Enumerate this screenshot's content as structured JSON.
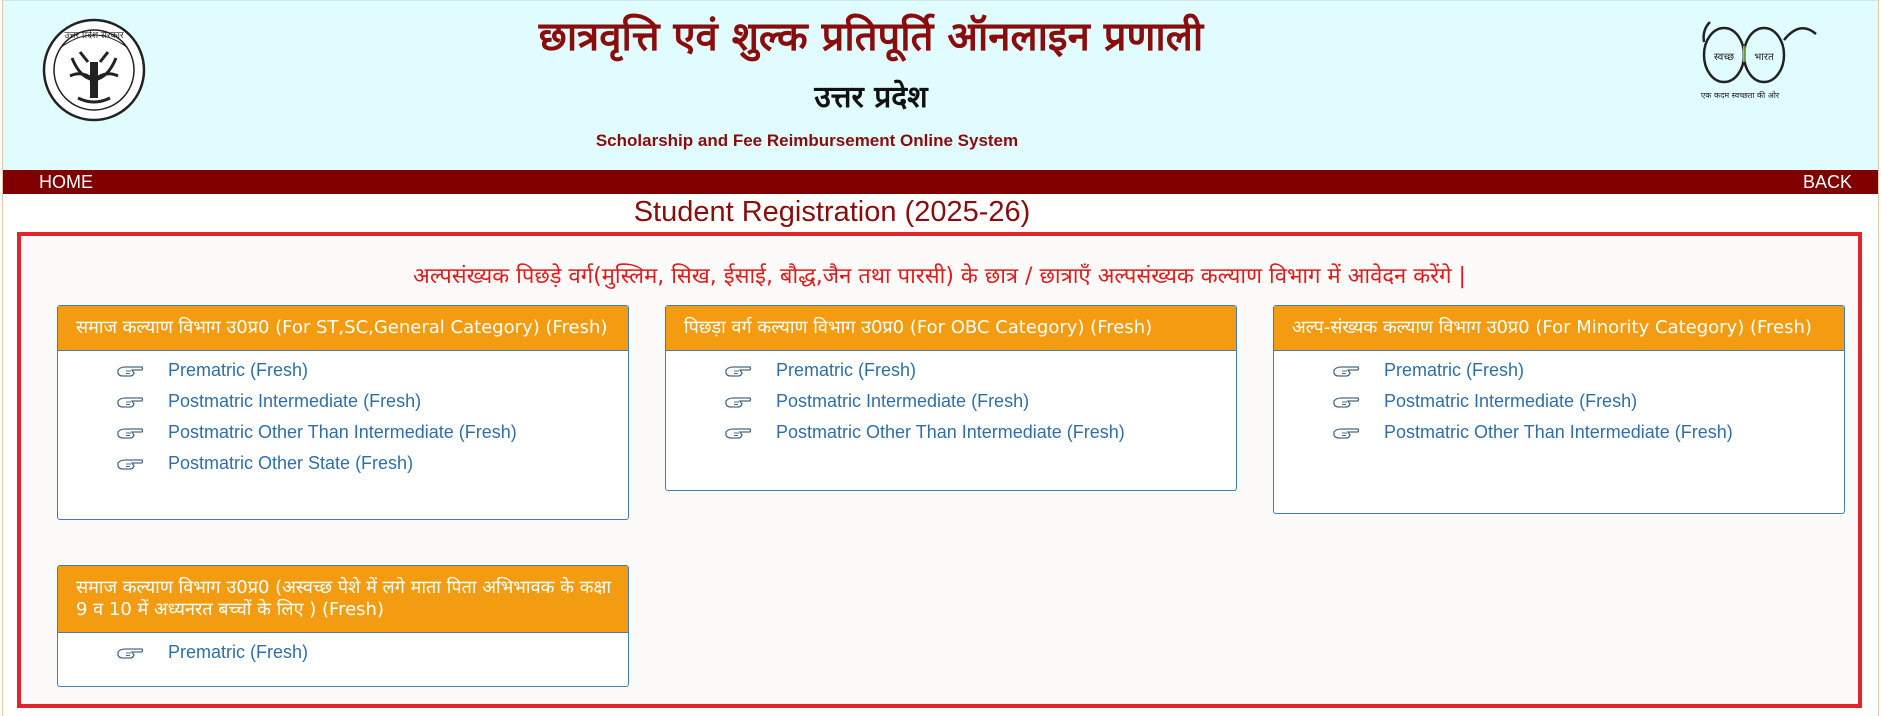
{
  "header": {
    "title_hi": "छात्रवृत्ति एवं शुल्क प्रतिपूर्ति ऑनलाइन प्रणाली",
    "state_hi": "उत्तर प्रदेश",
    "title_en": "Scholarship and Fee Reimbursement Online System",
    "emblem_icon": "up-government-emblem-icon",
    "swachh_icon": "swachh-bharat-glasses-icon"
  },
  "nav": {
    "home": "HOME",
    "back": "BACK"
  },
  "page_title": "Student Registration (2025-26)",
  "notice": "अल्पसंख्यक पिछड़े वर्ग(मुस्लिम, सिख, ईसाई, बौद्ध,जैन तथा पारसी) के छात्र / छात्राएँ अल्पसंख्यक कल्याण विभाग में आवेदन करेंगे |",
  "colors": {
    "maroon": "#800000",
    "orange": "#f39c12",
    "red_border": "#e0262a",
    "link_blue": "#2f6eaa",
    "header_bg": "#e0fcfe"
  },
  "panels": [
    {
      "title": "समाज कल्याण विभाग उ0प्र0 (For ST,SC,General Category) (Fresh)",
      "links": [
        "Prematric (Fresh)",
        "Postmatric Intermediate (Fresh)",
        "Postmatric Other Than Intermediate (Fresh)",
        "Postmatric Other State (Fresh)"
      ]
    },
    {
      "title": "पिछड़ा वर्ग कल्याण विभाग उ0प्र0 (For OBC Category) (Fresh)",
      "links": [
        "Prematric (Fresh)",
        "Postmatric Intermediate (Fresh)",
        "Postmatric Other Than Intermediate (Fresh)"
      ]
    },
    {
      "title": "अल्प-संख्यक कल्याण विभाग उ0प्र0 (For Minority Category) (Fresh)",
      "links": [
        "Prematric (Fresh)",
        "Postmatric Intermediate (Fresh)",
        "Postmatric Other Than Intermediate (Fresh)"
      ]
    },
    {
      "title": "समाज कल्याण विभाग उ0प्र0 (अस्वच्छ पेशे में लगे माता पिता अभिभावक के कक्षा 9 व 10 में अध्यनरत बच्चों के लिए ) (Fresh)",
      "links": [
        "Prematric (Fresh)"
      ]
    }
  ]
}
